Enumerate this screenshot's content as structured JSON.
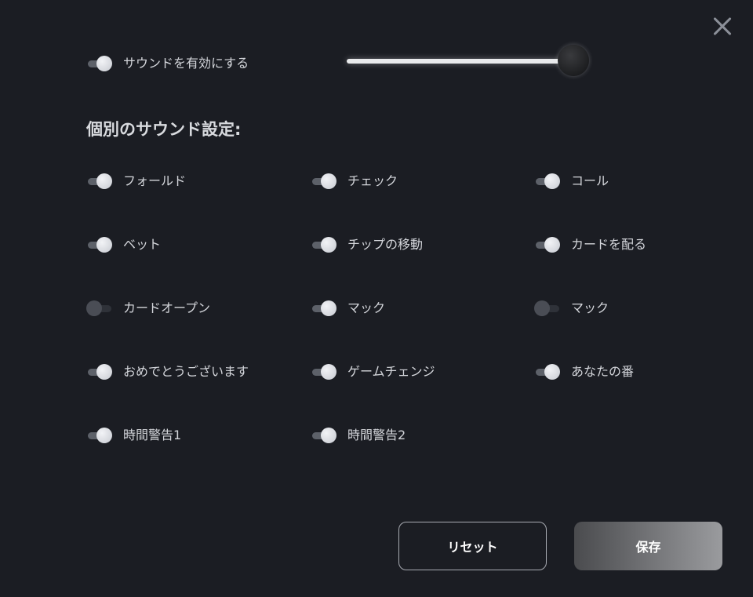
{
  "master": {
    "label": "サウンドを有効にする",
    "enabled": true,
    "volume": 1.0
  },
  "heading": "個別のサウンド設定:",
  "sounds": [
    {
      "label": "フォールド",
      "on": true
    },
    {
      "label": "チェック",
      "on": true
    },
    {
      "label": "コール",
      "on": true
    },
    {
      "label": "ベット",
      "on": true
    },
    {
      "label": "チップの移動",
      "on": true
    },
    {
      "label": "カードを配る",
      "on": true
    },
    {
      "label": "カードオープン",
      "on": false
    },
    {
      "label": "マック",
      "on": true
    },
    {
      "label": "マック",
      "on": false
    },
    {
      "label": "おめでとうございます",
      "on": true
    },
    {
      "label": "ゲームチェンジ",
      "on": true
    },
    {
      "label": "あなたの番",
      "on": true
    },
    {
      "label": "時間警告1",
      "on": true
    },
    {
      "label": "時間警告2",
      "on": true
    }
  ],
  "buttons": {
    "reset": "リセット",
    "save": "保存"
  }
}
